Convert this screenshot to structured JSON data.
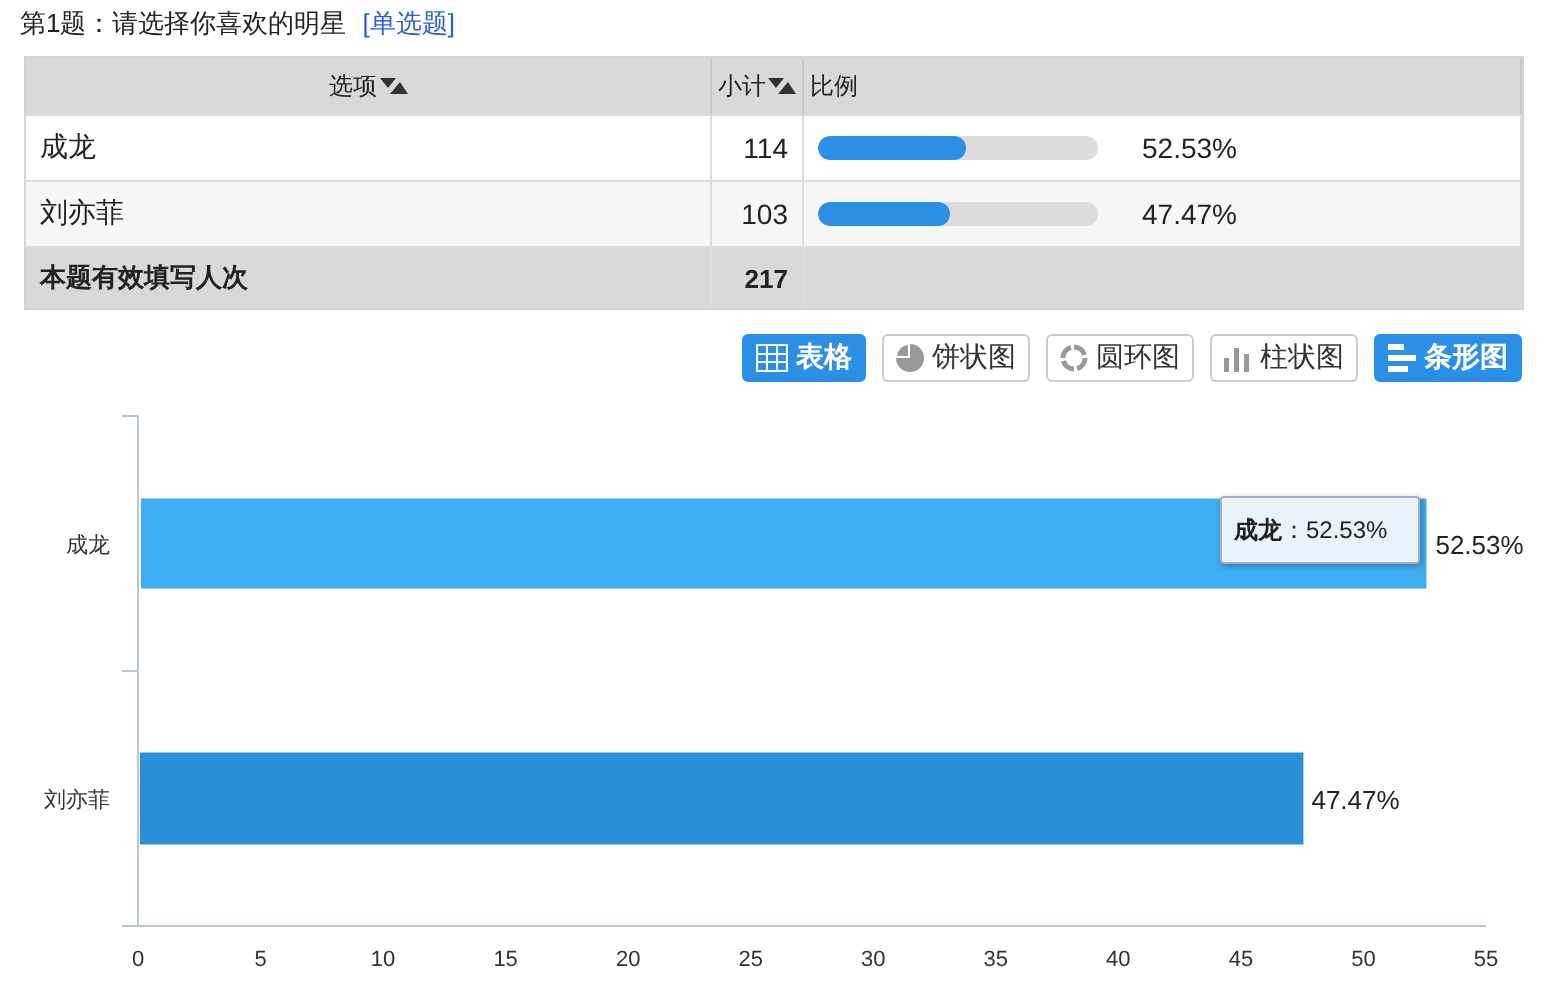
{
  "question": {
    "title": "第1题：请选择你喜欢的明星",
    "type_tag": "[单选题]"
  },
  "table": {
    "columns": [
      {
        "label": "选项",
        "sortable": true
      },
      {
        "label": "小计",
        "sortable": true
      },
      {
        "label": "比例",
        "sortable": false
      }
    ],
    "rows": [
      {
        "option": "成龙",
        "count": "114",
        "level": 0.5253,
        "percent": "52.53%"
      },
      {
        "option": "刘亦菲",
        "count": "103",
        "level": 0.4747,
        "percent": "47.47%"
      }
    ],
    "footer": {
      "label": "本题有效填写人次",
      "count": "217"
    }
  },
  "view_buttons": [
    {
      "kind": "table",
      "label": "表格",
      "selected": true
    },
    {
      "kind": "pie",
      "label": "饼状图",
      "selected": false
    },
    {
      "kind": "donut",
      "label": "圆环图",
      "selected": false
    },
    {
      "kind": "column",
      "label": "柱状图",
      "selected": false
    },
    {
      "kind": "bar",
      "label": "条形图",
      "selected": true
    }
  ],
  "chart": {
    "chart_data": {
      "type": "bar",
      "orientation": "horizontal",
      "categories": [
        "成龙",
        "刘亦菲"
      ],
      "series": [
        {
          "values": [
            52.53,
            47.47
          ]
        }
      ],
      "xlim": [
        0,
        55
      ],
      "xticks": [
        0,
        5,
        10,
        15,
        20,
        25,
        30,
        35,
        40,
        45,
        50,
        55
      ],
      "value_labels": [
        "52.53%",
        "47.47%"
      ]
    },
    "bars": [
      {
        "color": "#3fadf1",
        "hovered": true
      },
      {
        "color": "#2a8fd6",
        "hovered": false
      }
    ],
    "tooltip": "**成龙**：52.53%"
  }
}
